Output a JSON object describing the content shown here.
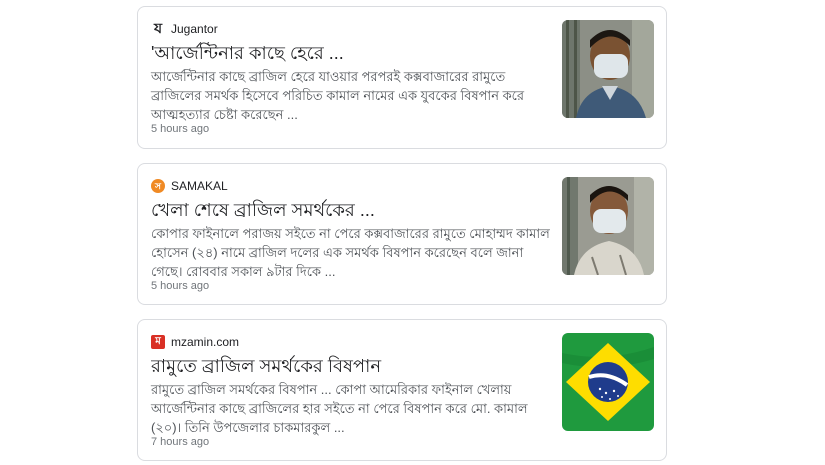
{
  "articles": [
    {
      "source": "Jugantor",
      "source_icon": "jugantor-logo-icon",
      "headline": "'আর্জেন্টিনার কাছে হেরে ...",
      "snippet": "আর্জেন্টিনার কাছে ব্রাজিল হেরে যাওয়ার পরপরই কক্সবাজারের রামুতে ব্রাজিলের সমর্থক হিসেবে পরিচিত কামাল নামের এক যুবকের বিষপান করে আত্মহত্যার চেষ্টা করেছেন ...",
      "time": "5 hours ago",
      "thumbnail": "man-with-mask-photo"
    },
    {
      "source": "SAMAKAL",
      "source_icon": "samakal-logo-icon",
      "headline": "খেলা শেষে ব্রাজিল সমর্থকের ...",
      "snippet": "কোপার ফাইনালে পরাজয় সইতে না পেরে কক্সবাজারের রামুতে মোহাম্মদ কামাল হোসেন (২৪) নামে ব্রাজিল দলের এক সমর্থক বিষপান করেছেন বলে জানা গেছে। রোববার সকাল ৯টার দিকে ...",
      "time": "5 hours ago",
      "thumbnail": "man-with-mask-photo"
    },
    {
      "source": "mzamin.com",
      "source_icon": "mzamin-logo-icon",
      "headline": "রামুতে ব্রাজিল সমর্থকের বিষপান",
      "snippet": "রামুতে ব্রাজিল সমর্থকের বিষপান ... কোপা আমেরিকার ফাইনাল খেলায় আর্জেন্টিনার কাছে ব্রাজিলের হার সইতে না পেরে বিষপান করে মো. কামাল (২০)। তিনি উপজেলার চাকমারকুল ...",
      "time": "7 hours ago",
      "thumbnail": "brazil-flag-image"
    }
  ],
  "colors": {
    "card_border": "#dadce0",
    "headline": "#202124",
    "snippet": "#4d5156",
    "time": "#70757a",
    "samakal_brand": "#f08a24",
    "mzamin_brand": "#d93025",
    "brazil_green": "#1f9a3e",
    "brazil_yellow": "#fedd00",
    "brazil_blue": "#1f3c8c"
  }
}
